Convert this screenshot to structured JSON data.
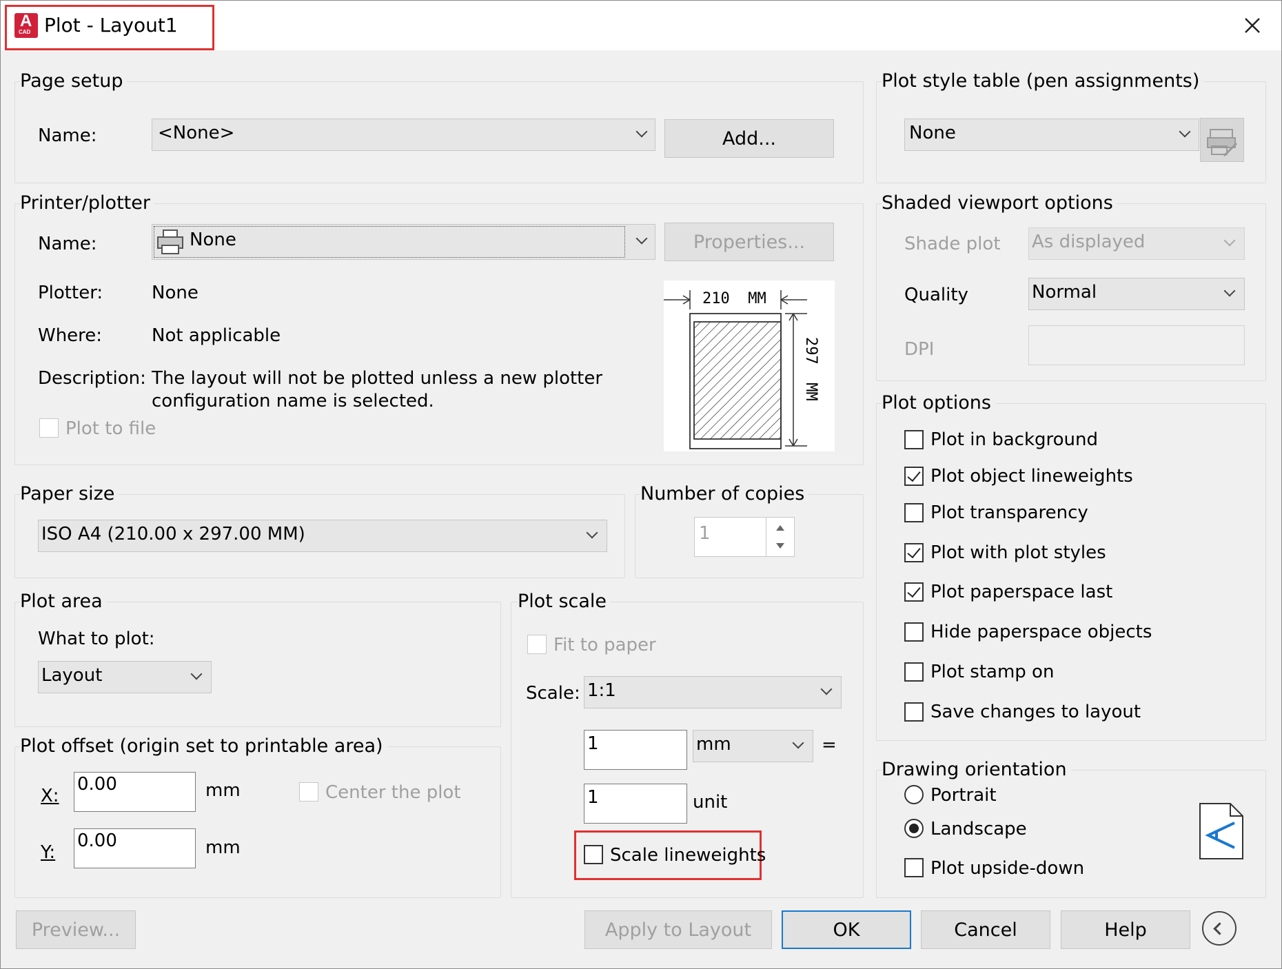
{
  "title": "Plot - Layout1",
  "app_icon": {
    "letter": "A",
    "sub": "CAD",
    "color": "#d0203a"
  },
  "page_setup": {
    "label": "Page setup",
    "name_label": "Name:",
    "name_value": "<None>",
    "add_button": "Add..."
  },
  "printer": {
    "label": "Printer/plotter",
    "name_label": "Name:",
    "name_value": "None",
    "properties_button": "Properties...",
    "plotter_label": "Plotter:",
    "plotter_value": "None",
    "where_label": "Where:",
    "where_value": "Not applicable",
    "description_label": "Description:",
    "description_line1": "The layout will not be plotted unless a new plotter",
    "description_line2": "configuration name is selected.",
    "plot_to_file": "Plot to file",
    "plot_to_file_checked": false,
    "preview_width": "210  MM",
    "preview_height": "297  MM"
  },
  "paper_size": {
    "label": "Paper size",
    "value": "ISO A4 (210.00 x 297.00 MM)"
  },
  "copies": {
    "label": "Number of copies",
    "value": "1"
  },
  "plot_area": {
    "label": "Plot area",
    "what_label": "What to plot:",
    "what_value": "Layout"
  },
  "plot_offset": {
    "label": "Plot offset (origin set to printable area)",
    "x_label": "X:",
    "x_value": "0.00",
    "x_unit": "mm",
    "y_label": "Y:",
    "y_value": "0.00",
    "y_unit": "mm",
    "center": "Center the plot",
    "center_checked": false
  },
  "plot_scale": {
    "label": "Plot scale",
    "fit": "Fit to paper",
    "fit_checked": false,
    "scale_label": "Scale:",
    "scale_value": "1:1",
    "value1": "1",
    "unit1": "mm",
    "equals": "=",
    "value2": "1",
    "unit2": "unit",
    "lineweights": "Scale lineweights",
    "lineweights_checked": false
  },
  "plot_style": {
    "label": "Plot style table (pen assignments)",
    "value": "None"
  },
  "shaded": {
    "label": "Shaded viewport options",
    "shade_label": "Shade plot",
    "shade_value": "As displayed",
    "quality_label": "Quality",
    "quality_value": "Normal",
    "dpi_label": "DPI"
  },
  "plot_options": {
    "label": "Plot options",
    "items": [
      {
        "label": "Plot in background",
        "checked": false
      },
      {
        "label": "Plot object lineweights",
        "checked": true
      },
      {
        "label": "Plot transparency",
        "checked": false
      },
      {
        "label": "Plot with plot styles",
        "checked": true
      },
      {
        "label": "Plot paperspace last",
        "checked": true
      },
      {
        "label": "Hide paperspace objects",
        "checked": false
      },
      {
        "label": "Plot stamp on",
        "checked": false
      },
      {
        "label": "Save changes to layout",
        "checked": false
      }
    ]
  },
  "orientation": {
    "label": "Drawing orientation",
    "portrait": "Portrait",
    "landscape": "Landscape",
    "selected": "Landscape",
    "upside_down": "Plot upside-down",
    "upside_down_checked": false
  },
  "buttons": {
    "preview": "Preview...",
    "apply": "Apply to Layout",
    "ok": "OK",
    "cancel": "Cancel",
    "help": "Help"
  },
  "highlight_color": "#e03030",
  "accent_color": "#1a78d0"
}
